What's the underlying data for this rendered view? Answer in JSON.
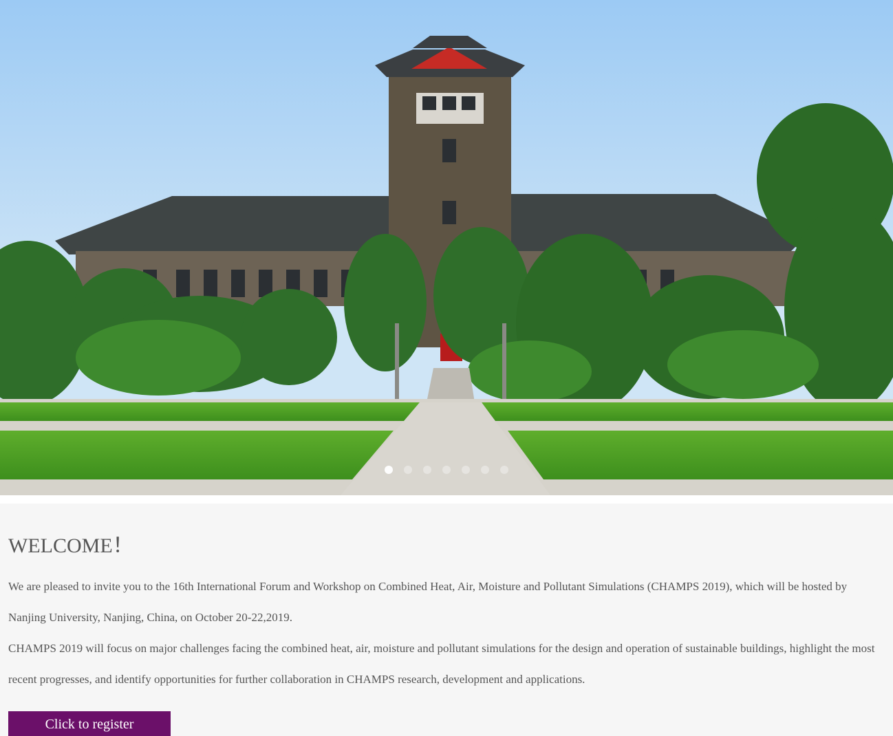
{
  "hero": {
    "slide_count": 7,
    "active_slide": 1
  },
  "welcome": {
    "title": "WELCOME！",
    "paragraph1": "We are pleased to invite you to the 16th International Forum and Workshop on Combined Heat, Air, Moisture and Pollutant Simulations (CHAMPS 2019), which will be hosted by Nanjing University, Nanjing, China, on October 20-22,2019.",
    "paragraph2": "CHAMPS 2019 will focus on major challenges facing the combined heat, air, moisture and pollutant simulations for the design and operation of sustainable buildings, highlight the most recent progresses, and identify opportunities for further collaboration in CHAMPS research, development and applications.",
    "register_label": "Click to register"
  },
  "colors": {
    "button": "#6b1069",
    "text": "#555555",
    "background": "#f6f6f6"
  }
}
